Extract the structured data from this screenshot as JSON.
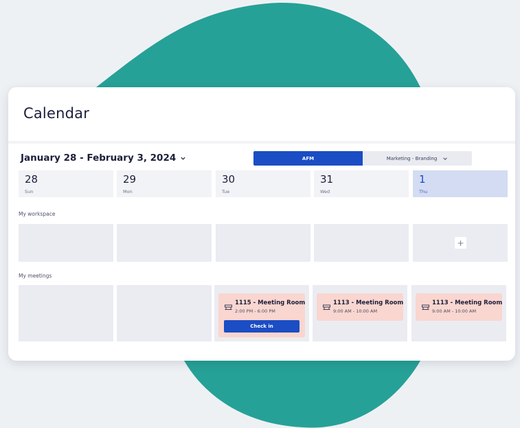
{
  "colors": {
    "blob": "#26a197",
    "primary": "#1b4dc4",
    "meeting_bg": "#f9d6cf",
    "active_day_bg": "#d3dcf2"
  },
  "page": {
    "title": "Calendar"
  },
  "toolbar": {
    "date_range": "January 28 - February 3, 2024",
    "segments": {
      "first": "AFM",
      "second": "Marketing - Branding"
    }
  },
  "days": [
    {
      "num": "28",
      "name": "Sun"
    },
    {
      "num": "29",
      "name": "Mon"
    },
    {
      "num": "30",
      "name": "Tue"
    },
    {
      "num": "31",
      "name": "Wed"
    },
    {
      "num": "1",
      "name": "Thu"
    }
  ],
  "workspace": {
    "label": "My workspace",
    "add_label": "+"
  },
  "meetings": {
    "label": "My meetings",
    "items": [
      {
        "title": "1115 - Meeting Room",
        "time": "2:00 PM - 6:00 PM",
        "action": "Check in"
      },
      {
        "title": "1113 - Meeting Room",
        "time": "9:00 AM - 10:00 AM"
      },
      {
        "title": "1113 - Meeting Room",
        "time": "9:00 AM - 10:00 AM"
      }
    ]
  }
}
